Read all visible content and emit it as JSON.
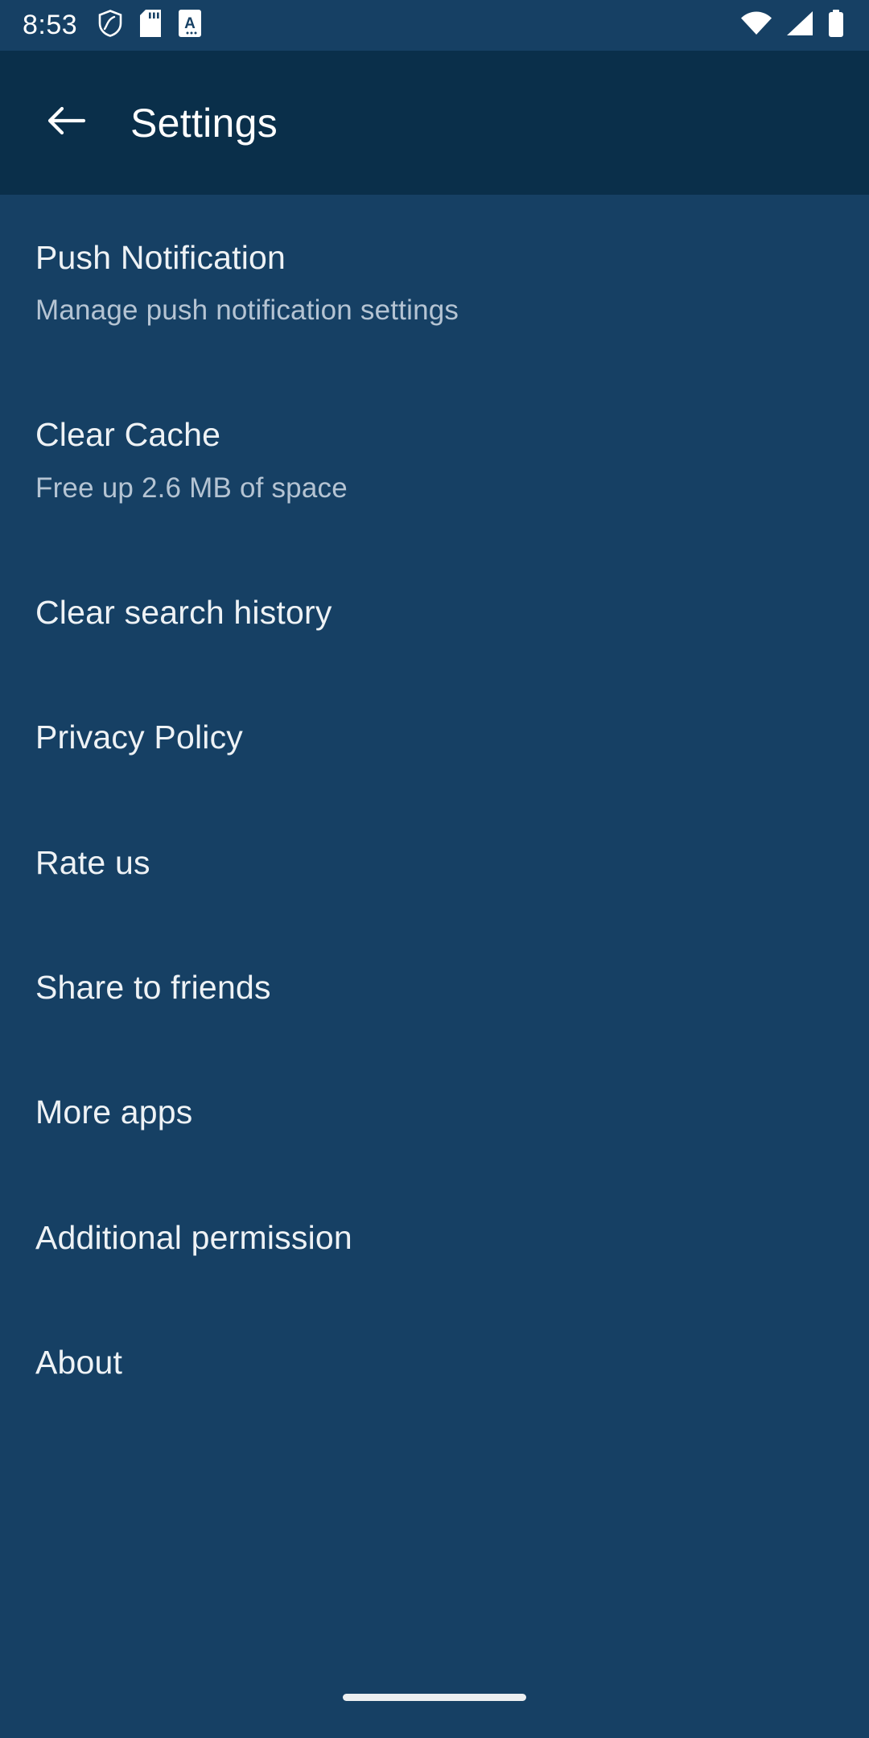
{
  "theme": {
    "statusbar_bg": "#164064",
    "appbar_bg": "#0a2f4a",
    "body_bg": "#164064",
    "title_color": "#eef2f5",
    "subtitle_color": "#b5c4d3",
    "icon_color": "#ffffff"
  },
  "statusbar": {
    "time": "8:53",
    "left_icons": [
      "shield-icon",
      "sd-card-icon",
      "a-font-icon"
    ],
    "right_icons": [
      "wifi-icon",
      "cellular-signal-icon",
      "battery-icon"
    ]
  },
  "appbar": {
    "back_icon": "arrow-left-icon",
    "title": "Settings"
  },
  "settings": {
    "items": [
      {
        "title": "Push Notification",
        "subtitle": "Manage push notification settings"
      },
      {
        "title": "Clear Cache",
        "subtitle": "Free up 2.6 MB of space"
      },
      {
        "title": "Clear search history",
        "subtitle": ""
      },
      {
        "title": "Privacy Policy",
        "subtitle": ""
      },
      {
        "title": "Rate us",
        "subtitle": ""
      },
      {
        "title": "Share to friends",
        "subtitle": ""
      },
      {
        "title": "More apps",
        "subtitle": ""
      },
      {
        "title": "Additional permission",
        "subtitle": ""
      },
      {
        "title": "About",
        "subtitle": ""
      }
    ]
  },
  "navbar": {
    "home_indicator": "home-indicator-pill"
  }
}
